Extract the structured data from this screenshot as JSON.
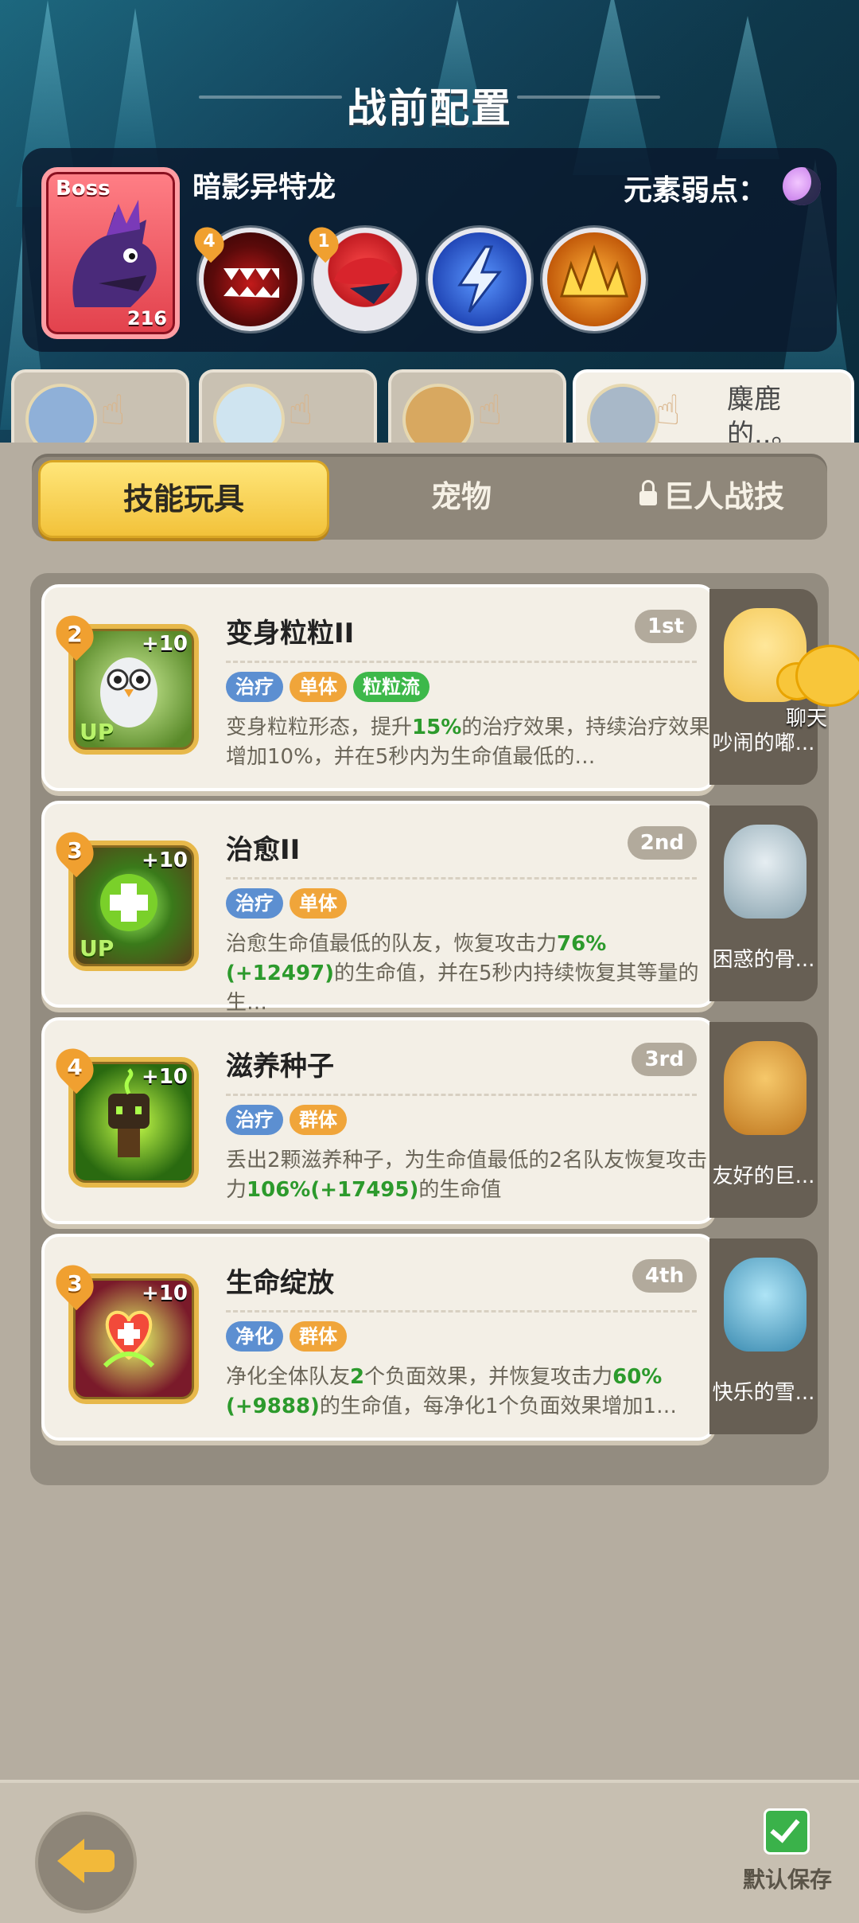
{
  "header": {
    "title": "战前配置",
    "boss": {
      "tag": "Boss",
      "name": "暗影异特龙",
      "level": "216",
      "weakness_label": "元素弱点：",
      "weakness_icon": "moon-icon"
    },
    "boss_skills": [
      {
        "name": "fang-mouth-icon",
        "badge": "4",
        "color": "#7a1010"
      },
      {
        "name": "red-bird-icon",
        "badge": "1",
        "color": "#d8242c"
      },
      {
        "name": "lightning-icon",
        "badge": "",
        "color": "#2f66d6"
      },
      {
        "name": "crown-spikes-icon",
        "badge": "",
        "color": "#d47a16"
      }
    ]
  },
  "team_tabs": [
    {
      "name": "team-slot-1",
      "avatar_color": "#8fb0d8",
      "label": ""
    },
    {
      "name": "team-slot-2",
      "avatar_color": "#cfe4f0",
      "label": ""
    },
    {
      "name": "team-slot-3",
      "avatar_color": "#d8a860",
      "label": ""
    },
    {
      "name": "team-slot-4",
      "avatar_color": "#a8b8c8",
      "label": "麋鹿的..。"
    }
  ],
  "segments": {
    "active": "技能玩具",
    "pets": "宠物",
    "locked": "巨人战技"
  },
  "skills": [
    {
      "name": "变身粒粒II",
      "rank": "1st",
      "level": "2",
      "bonus": "+10",
      "up": "UP",
      "icon_color": "#5a8a2a",
      "tags": [
        {
          "text": "治疗",
          "color": "blue"
        },
        {
          "text": "单体",
          "color": "orange"
        },
        {
          "text": "粒粒流",
          "color": "green"
        }
      ],
      "desc_parts": [
        "变身粒粒形态，提升",
        "15%",
        "的治疗效果，持续治疗效果增加10%，并在5秒内为生命值最低的…"
      ],
      "pet_name": "吵闹的嘟...",
      "pet_color": "#f2c24a"
    },
    {
      "name": "治愈II",
      "rank": "2nd",
      "level": "3",
      "bonus": "+10",
      "up": "UP",
      "icon_color": "#3a7a1a",
      "tags": [
        {
          "text": "治疗",
          "color": "blue"
        },
        {
          "text": "单体",
          "color": "orange"
        }
      ],
      "desc_parts": [
        "治愈生命值最低的队友，恢复攻击力",
        "76%(+12497)",
        "的生命值，并在5秒内持续恢复其等量的生…"
      ],
      "pet_name": "困惑的骨...",
      "pet_color": "#b8c8d0"
    },
    {
      "name": "滋养种子",
      "rank": "3rd",
      "level": "4",
      "bonus": "+10",
      "up": "",
      "icon_color": "#2a6a10",
      "tags": [
        {
          "text": "治疗",
          "color": "blue"
        },
        {
          "text": "群体",
          "color": "orange"
        }
      ],
      "desc_parts": [
        "丢出2颗滋养种子，为生命值最低的2名队友恢复攻击力",
        "106%(+17495)",
        "的生命值"
      ],
      "pet_name": "友好的巨...",
      "pet_color": "#e0a03a"
    },
    {
      "name": "生命绽放",
      "rank": "4th",
      "level": "3",
      "bonus": "+10",
      "up": "",
      "icon_color": "#7a1a2a",
      "tags": [
        {
          "text": "净化",
          "color": "blue"
        },
        {
          "text": "群体",
          "color": "orange"
        }
      ],
      "desc_parts": [
        "净化全体队友",
        "2",
        "个负面效果，并恢复攻击力",
        "60%(+9888)",
        "的生命值，每净化1个负面效果增加1…"
      ],
      "pet_name": "快乐的雪...",
      "pet_color": "#6ab8d8"
    }
  ],
  "chat": {
    "label": "聊天"
  },
  "footer": {
    "save_label": "默认保存"
  }
}
